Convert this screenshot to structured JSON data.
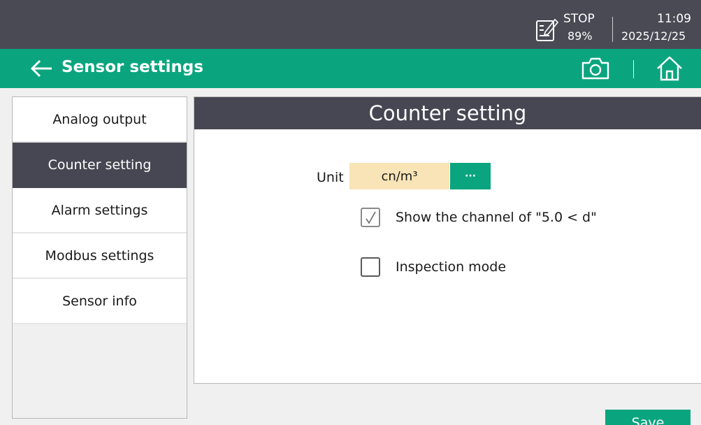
{
  "status": {
    "mode": "STOP",
    "battery": "89%",
    "time": "11:09",
    "date": "2025/12/25"
  },
  "header": {
    "title": "Sensor settings",
    "back_icon": "arrow-left-icon",
    "camera_icon": "camera-icon",
    "home_icon": "home-icon"
  },
  "sidebar": {
    "items": [
      {
        "label": "Analog output",
        "active": false
      },
      {
        "label": "Counter setting",
        "active": true
      },
      {
        "label": "Alarm settings",
        "active": false
      },
      {
        "label": "Modbus settings",
        "active": false
      },
      {
        "label": "Sensor info",
        "active": false
      }
    ]
  },
  "panel": {
    "title": "Counter setting",
    "unit_label": "Unit",
    "unit_value": "cn/m³",
    "unit_button": "···",
    "show_channel": {
      "label": "Show the channel of \"5.0 < d\"",
      "checked": true
    },
    "inspection_mode": {
      "label": "Inspection mode",
      "checked": false
    }
  },
  "footer": {
    "save_label": "Save"
  },
  "colors": {
    "accent": "#0aa57f",
    "dark": "#474753",
    "unit_field": "#f8e4b6"
  }
}
